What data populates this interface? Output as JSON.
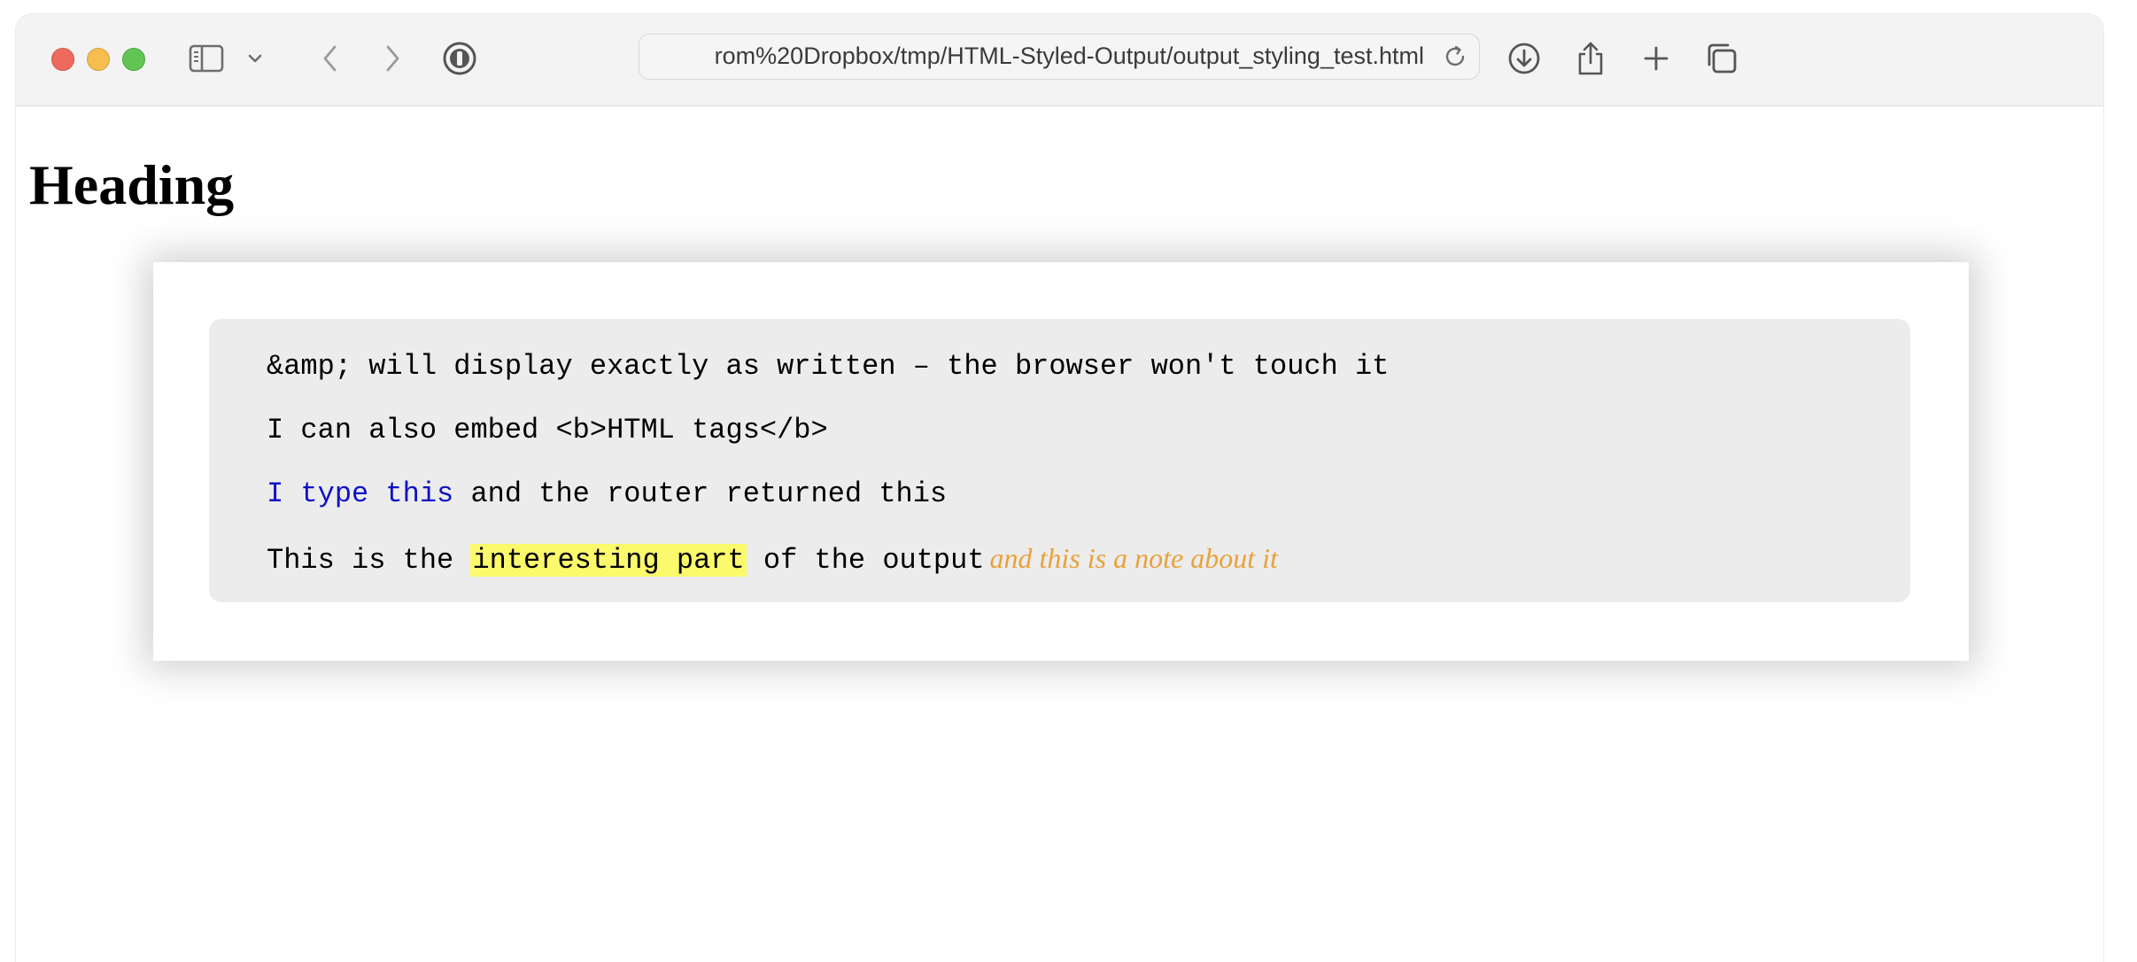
{
  "browser": {
    "url": "rom%20Dropbox/tmp/HTML-Styled-Output/output_styling_test.html",
    "icons": {
      "sidebar": "sidebar-icon",
      "sidebar_menu": "chevron-down-icon",
      "back": "chevron-left-icon",
      "forward": "chevron-right-icon",
      "password": "password-manager-icon",
      "reload": "reload-icon",
      "downloads": "download-icon",
      "share": "share-icon",
      "new_tab": "plus-icon",
      "tabs": "tab-overview-icon"
    },
    "traffic_lights": {
      "close": "#ed6a5e",
      "minimize": "#f5be4f",
      "maximize": "#61c554"
    }
  },
  "page": {
    "heading": "Heading",
    "output": {
      "line1": "&amp; will display exactly as written – the browser won't touch it",
      "line2": "I can also embed <b>HTML tags</b>",
      "line3": {
        "typed": "I type this",
        "rest": " and the router returned this"
      },
      "line4": {
        "before": "This is the ",
        "highlight": "interesting part",
        "after": " of the output",
        "note": "and this is a note about it"
      }
    },
    "colors": {
      "typed_text": "#1010c8",
      "highlight": "#fbfa6c",
      "note": "#e8a23a",
      "output_background": "#ececec"
    }
  }
}
